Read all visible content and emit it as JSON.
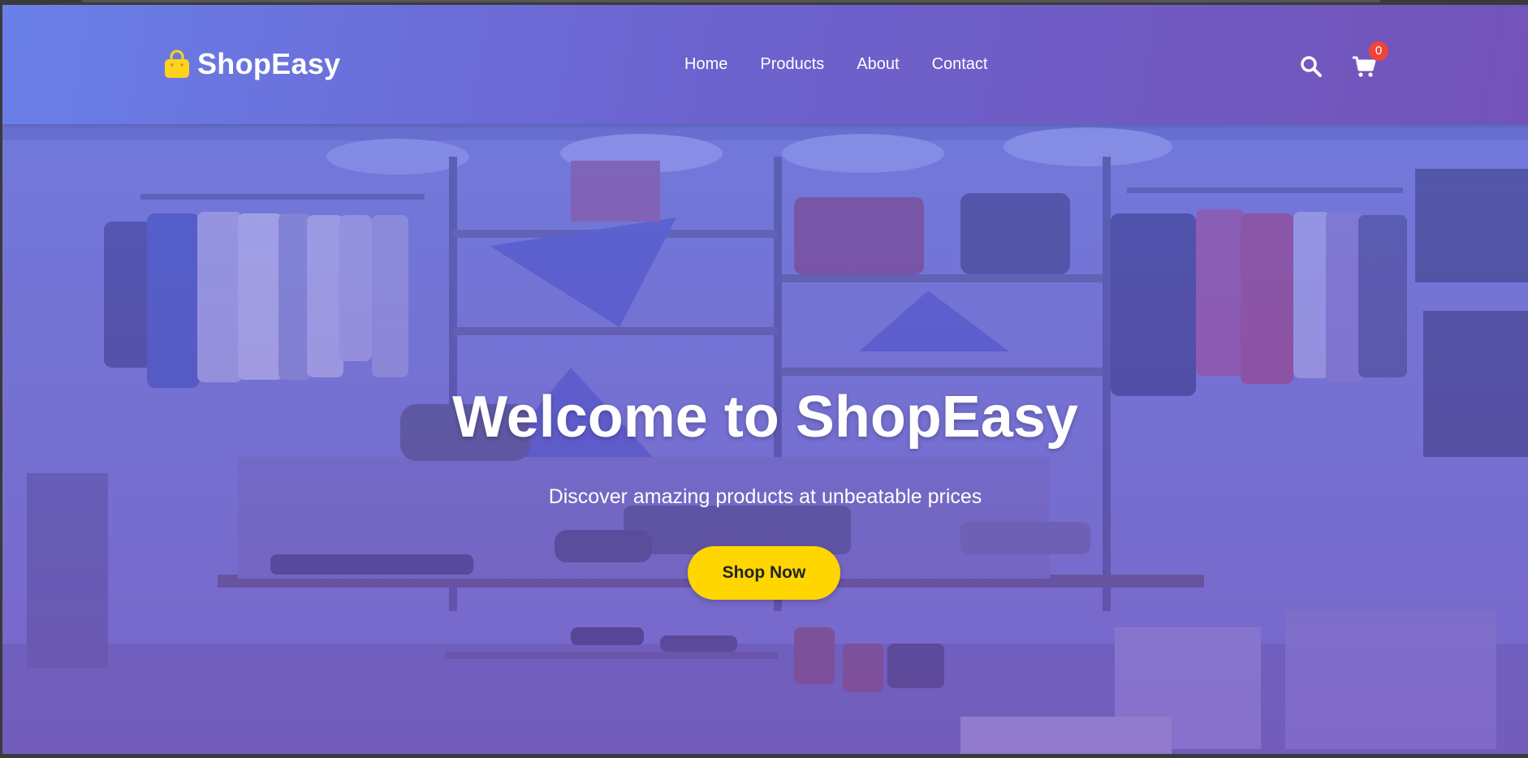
{
  "brand": {
    "name": "ShopEasy",
    "icon": "shopping-bag-icon",
    "icon_color": "#ffd21f"
  },
  "nav": {
    "items": [
      {
        "label": "Home"
      },
      {
        "label": "Products"
      },
      {
        "label": "About"
      },
      {
        "label": "Contact"
      }
    ]
  },
  "actions": {
    "search_icon": "search-icon",
    "cart_icon": "cart-icon",
    "cart_count": "0"
  },
  "hero": {
    "title": "Welcome to ShopEasy",
    "subtitle": "Discover amazing products at unbeatable prices",
    "cta_label": "Shop Now",
    "background": "clothing-store-photo"
  },
  "colors": {
    "nav_gradient_start": "#6a7fe8",
    "nav_gradient_end": "#7353b8",
    "cta": "#ffd600",
    "badge": "#f0433a"
  }
}
